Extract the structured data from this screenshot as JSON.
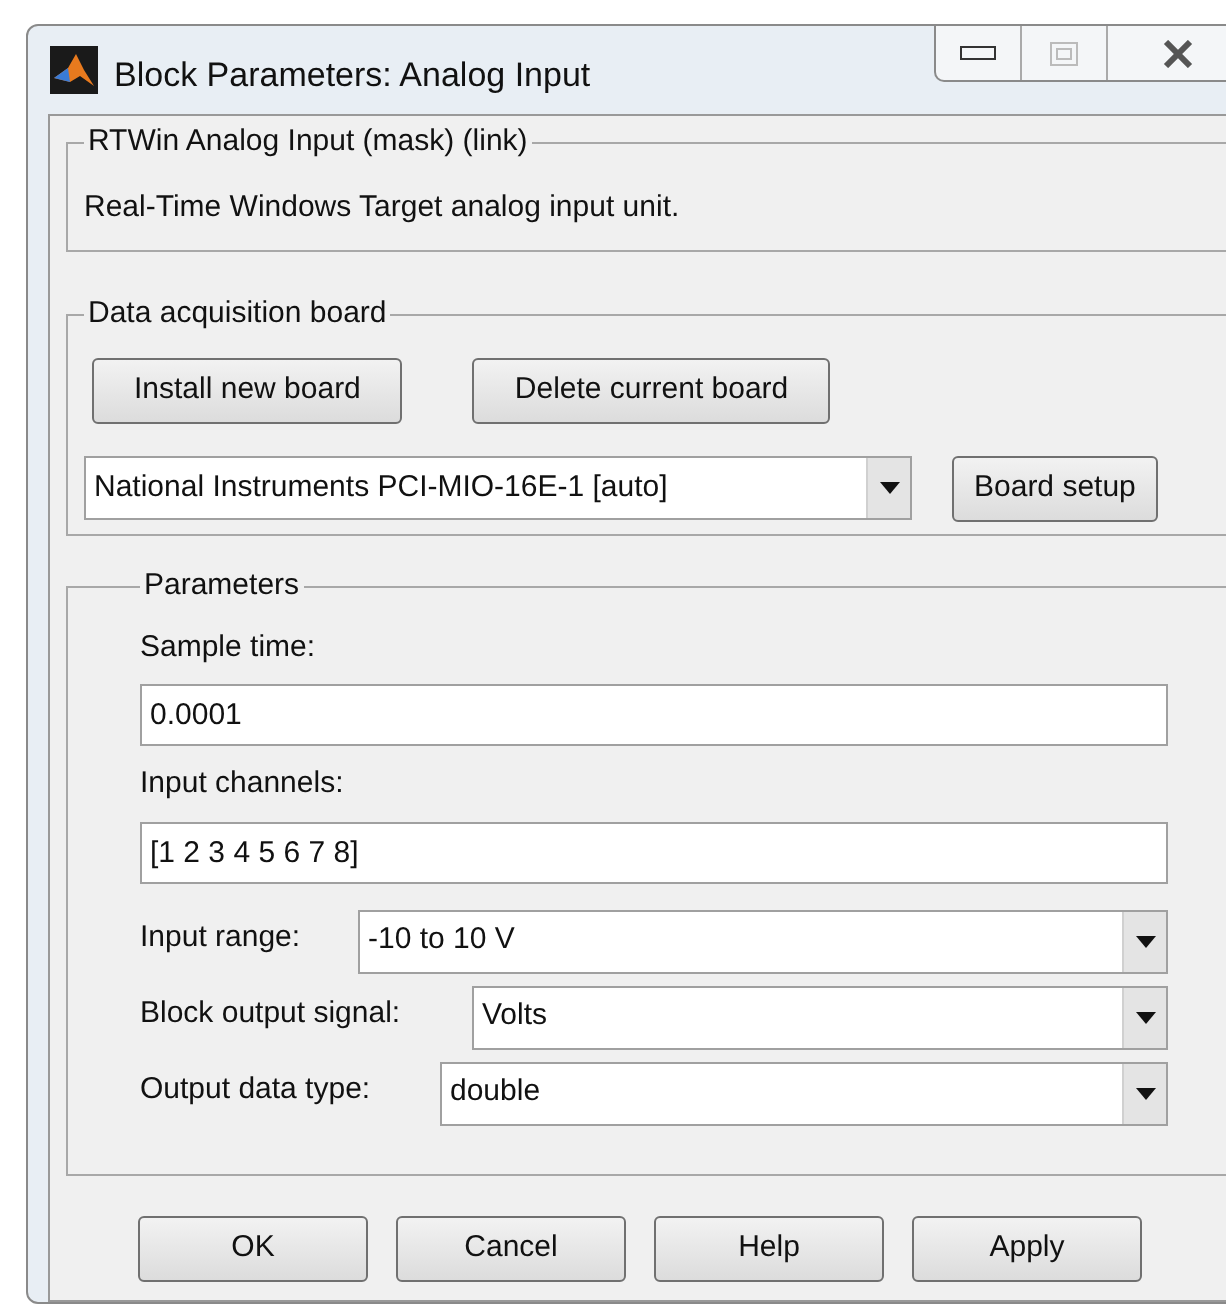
{
  "window": {
    "title": "Block Parameters: Analog Input"
  },
  "description_group": {
    "title": "RTWin Analog Input (mask) (link)",
    "text": "Real-Time Windows Target analog input unit."
  },
  "board_group": {
    "title": "Data acquisition board",
    "buttons": [
      "Install new board",
      "Delete current board"
    ],
    "board": {
      "value": "National Instruments PCI-MIO-16E-1 [auto]"
    },
    "setup_button": "Board setup"
  },
  "parameters": {
    "title": "Parameters",
    "fields": [
      {
        "kind": "text",
        "label": "Sample time:",
        "value": "0.0001"
      },
      {
        "kind": "text",
        "label": "Input channels:",
        "value": "[1 2 3 4 5 6 7 8]"
      },
      {
        "kind": "select",
        "label": "Input range:",
        "value": "-10 to 10 V"
      },
      {
        "kind": "select",
        "label": "Block output signal:",
        "value": "Volts"
      },
      {
        "kind": "select",
        "label": "Output data type:",
        "value": "double"
      }
    ]
  },
  "buttons": [
    "OK",
    "Cancel",
    "Help",
    "Apply"
  ]
}
